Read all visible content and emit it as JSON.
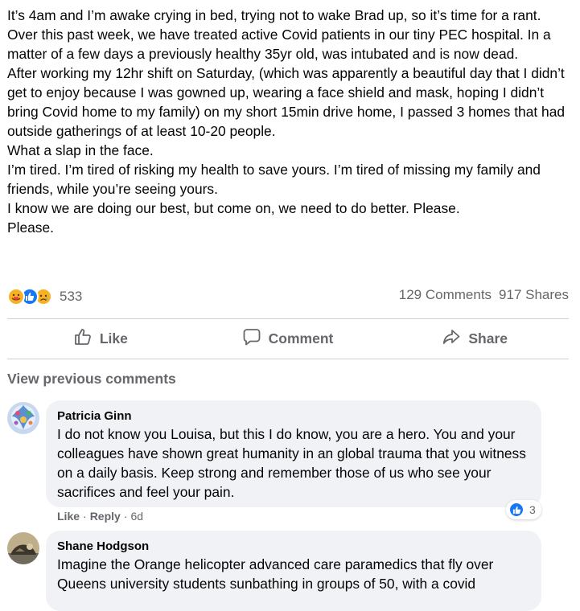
{
  "post": {
    "lines": [
      "It’s 4am and I’m awake crying in bed, trying not to wake Brad up, so it’s time for a rant.",
      "Over this past week, we have treated active Covid patients in our tiny PEC hospital. In a matter of a few days a previously healthy 35yr old, was intubated and is now dead.",
      "After working my 12hr shift on Saturday, (which was apparently a beautiful day that I didn’t get to enjoy because I was gowned up, wearing a face shield and mask, hoping I didn’t bring Covid home to my family) on my short 15min drive home, I passed 3 homes that had outside gatherings of at least 10-20 people.",
      "What a slap in the face.",
      "I’m tired. I’m tired of risking my health to save yours. I’m tired of missing my family and friends, while you’re seeing yours.",
      "I know we are doing our best, but come on, we need to do better. Please.",
      "Please."
    ]
  },
  "reactions": {
    "icons": [
      "care-reaction-icon",
      "like-reaction-icon",
      "sad-reaction-icon"
    ],
    "count": "533",
    "comments": "129 Comments",
    "shares": "917 Shares"
  },
  "actions": {
    "like": "Like",
    "comment": "Comment",
    "share": "Share"
  },
  "comments_section": {
    "view_previous": "View previous comments",
    "comments": [
      {
        "author": "Patricia Ginn",
        "text": "I do not know you Louisa, but this I do know, you are a hero. You and your colleagues have shown great humanity in an global trauma that you witness on a daily basis. Keep strong and remember those of us who see your sacrifices and feel your pain.",
        "like": "Like",
        "reply": "Reply",
        "sep": "·",
        "time": "6d",
        "reaction_count": "3"
      },
      {
        "author": "Shane Hodgson",
        "text": "Imagine the Orange helicopter advanced care paramedics that fly over Queens university students sunbathing in groups of 50, with a covid"
      }
    ]
  },
  "colors": {
    "text": "#050505",
    "secondary": "#65676b",
    "bubble": "#f0f2f5",
    "like_blue": "#1877f2",
    "emoji_yellow": "#f7b125"
  }
}
